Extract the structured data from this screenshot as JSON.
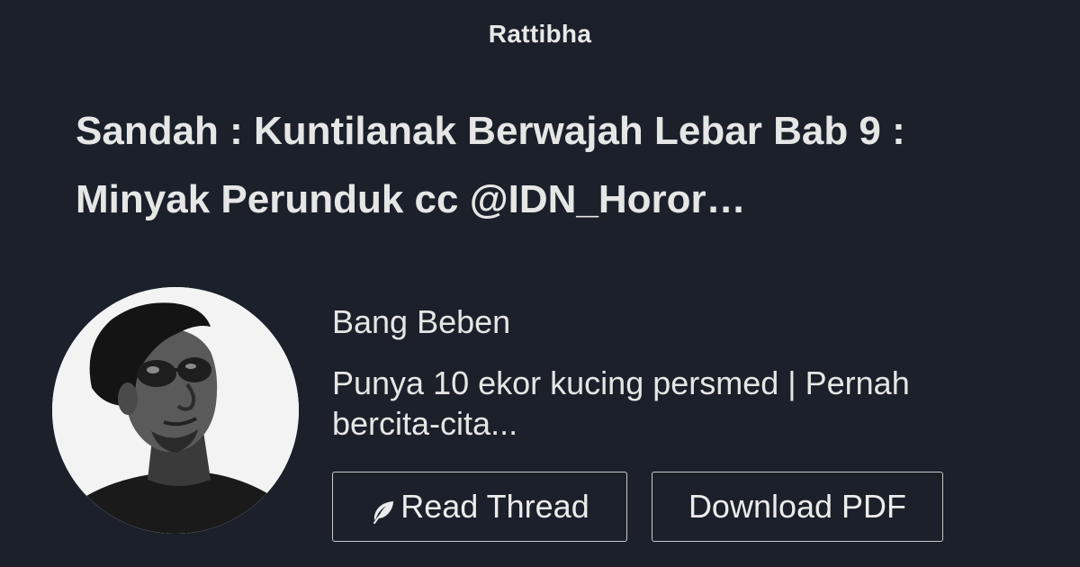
{
  "site": {
    "brand": "Rattibha"
  },
  "thread": {
    "title": "Sandah : Kuntilanak Berwajah Lebar Bab 9 : Minyak Perunduk cc @IDN_Horor…"
  },
  "author": {
    "name": "Bang Beben",
    "bio": "Punya 10 ekor kucing persmed | Pernah bercita-cita..."
  },
  "actions": {
    "read_thread_label": "Read Thread",
    "read_thread_icon": "feather-icon",
    "download_pdf_label": "Download PDF"
  },
  "colors": {
    "background": "#1b202a",
    "text": "#e6e6e6",
    "button_border": "#c9c9c9"
  }
}
